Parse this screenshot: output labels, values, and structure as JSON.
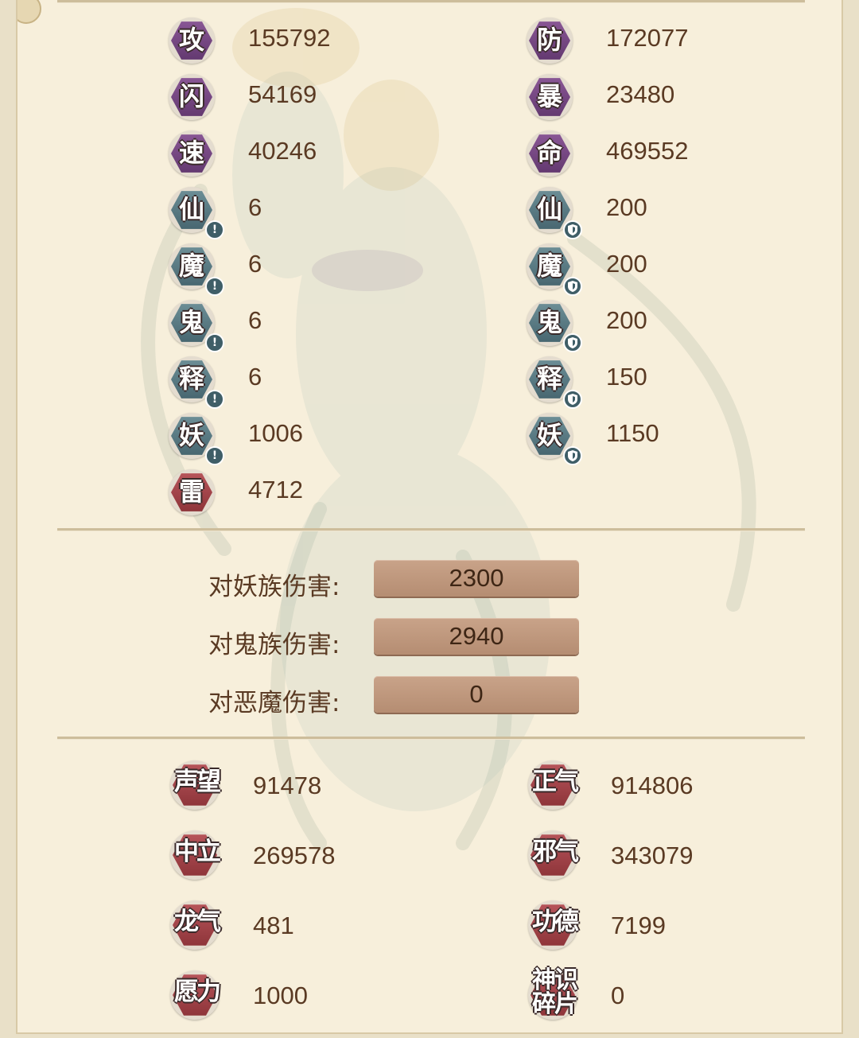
{
  "attributes": [
    {
      "glyph": "攻",
      "value": "155792",
      "color": "purple"
    },
    {
      "glyph": "防",
      "value": "172077",
      "color": "purple"
    },
    {
      "glyph": "闪",
      "value": "54169",
      "color": "purple"
    },
    {
      "glyph": "暴",
      "value": "23480",
      "color": "purple"
    },
    {
      "glyph": "速",
      "value": "40246",
      "color": "purple"
    },
    {
      "glyph": "命",
      "value": "469552",
      "color": "purple"
    }
  ],
  "race_stats": [
    {
      "glyph": "仙",
      "attack": "6",
      "defense": "200"
    },
    {
      "glyph": "魔",
      "attack": "6",
      "defense": "200"
    },
    {
      "glyph": "鬼",
      "attack": "6",
      "defense": "200"
    },
    {
      "glyph": "释",
      "attack": "6",
      "defense": "150"
    },
    {
      "glyph": "妖",
      "attack": "1006",
      "defense": "1150"
    }
  ],
  "race_markers": {
    "attack_mark": "!",
    "defense_mark": "shield-icon"
  },
  "thunder": {
    "glyph": "雷",
    "value": "4712"
  },
  "damage": [
    {
      "label": "对妖族伤害:",
      "value": "2300"
    },
    {
      "label": "对鬼族伤害:",
      "value": "2940"
    },
    {
      "label": "对恶魔伤害:",
      "value": "0"
    }
  ],
  "reputation": [
    {
      "label": "声望",
      "value": "91478"
    },
    {
      "label": "正气",
      "value": "914806"
    },
    {
      "label": "中立",
      "value": "269578"
    },
    {
      "label": "邪气",
      "value": "343079"
    },
    {
      "label": "龙气",
      "value": "481"
    },
    {
      "label": "功德",
      "value": "7199"
    },
    {
      "label": "愿力",
      "value": "1000"
    },
    {
      "label": "神识碎片",
      "value": "0",
      "label_line1": "神识",
      "label_line2": "碎片"
    }
  ],
  "colors": {
    "background": "#f7efdb",
    "text": "#5a3a23",
    "hex_purple": "#7a4786",
    "hex_teal": "#587880",
    "hex_red": "#a4444a",
    "damage_box": "#c09a7f"
  }
}
